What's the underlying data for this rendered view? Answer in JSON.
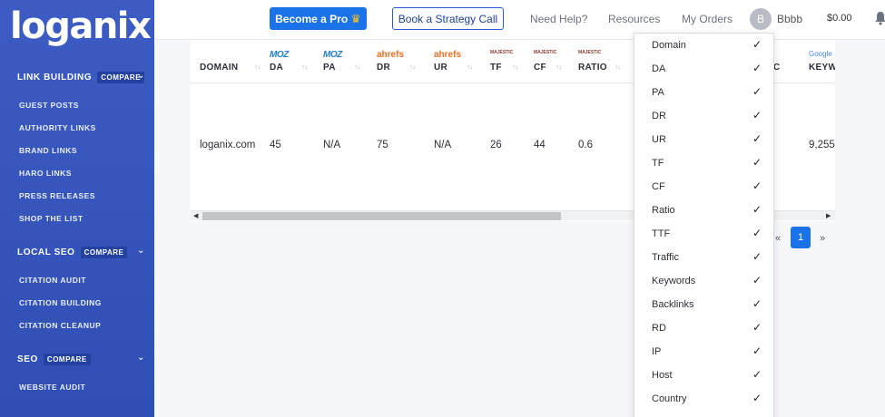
{
  "sidebar": {
    "logo": "loganix",
    "sections": [
      {
        "title": "LINK BUILDING",
        "badge": "COMPARE",
        "items": [
          "GUEST POSTS",
          "AUTHORITY LINKS",
          "BRAND LINKS",
          "HARO LINKS",
          "PRESS RELEASES",
          "SHOP THE LIST"
        ]
      },
      {
        "title": "LOCAL SEO",
        "badge": "COMPARE",
        "items": [
          "CITATION AUDIT",
          "CITATION BUILDING",
          "CITATION CLEANUP"
        ]
      },
      {
        "title": "SEO",
        "badge": "COMPARE",
        "items": [
          "WEBSITE AUDIT"
        ]
      }
    ]
  },
  "topbar": {
    "become_pro": "Become a Pro",
    "strategy_call": "Book a Strategy Call",
    "need_help": "Need Help?",
    "resources": "Resources",
    "my_orders": "My Orders",
    "avatar_letter": "B",
    "username": "Bbbb",
    "balance": "$0.00"
  },
  "table": {
    "columns": [
      {
        "brand": "",
        "label": "DOMAIN"
      },
      {
        "brand": "MOZ",
        "label": "DA"
      },
      {
        "brand": "MOZ",
        "label": "PA"
      },
      {
        "brand": "ahrefs",
        "label": "DR"
      },
      {
        "brand": "ahrefs",
        "label": "UR"
      },
      {
        "brand": "MAJESTIC",
        "label": "TF"
      },
      {
        "brand": "MAJESTIC",
        "label": "CF"
      },
      {
        "brand": "MAJESTIC",
        "label": "RATIO"
      },
      {
        "brand": "",
        "label": "C"
      },
      {
        "brand": "Google",
        "label": "KEYW"
      }
    ],
    "row": {
      "domain": "loganix.com",
      "da": "45",
      "pa": "N/A",
      "dr": "75",
      "ur": "N/A",
      "tf": "26",
      "cf": "44",
      "ratio": "0.6",
      "keywords": "9,255"
    }
  },
  "pagination": {
    "prev": "«",
    "page": "1",
    "next": "»"
  },
  "column_dropdown": {
    "items": [
      "Domain",
      "DA",
      "PA",
      "DR",
      "UR",
      "TF",
      "CF",
      "Ratio",
      "TTF",
      "Traffic",
      "Keywords",
      "Backlinks",
      "RD",
      "IP",
      "Host",
      "Country"
    ],
    "check_glyph": "✓"
  },
  "colors": {
    "sidebar": "#3c5cc4",
    "primary": "#1a73e8",
    "moz": "#1f7fd1",
    "ahrefs": "#f26d21"
  },
  "icons": {
    "sort": "sort-icon",
    "chevron": "chevron-down-icon",
    "crown": "crown-icon",
    "bell": "bell-icon",
    "check": "check-icon"
  }
}
